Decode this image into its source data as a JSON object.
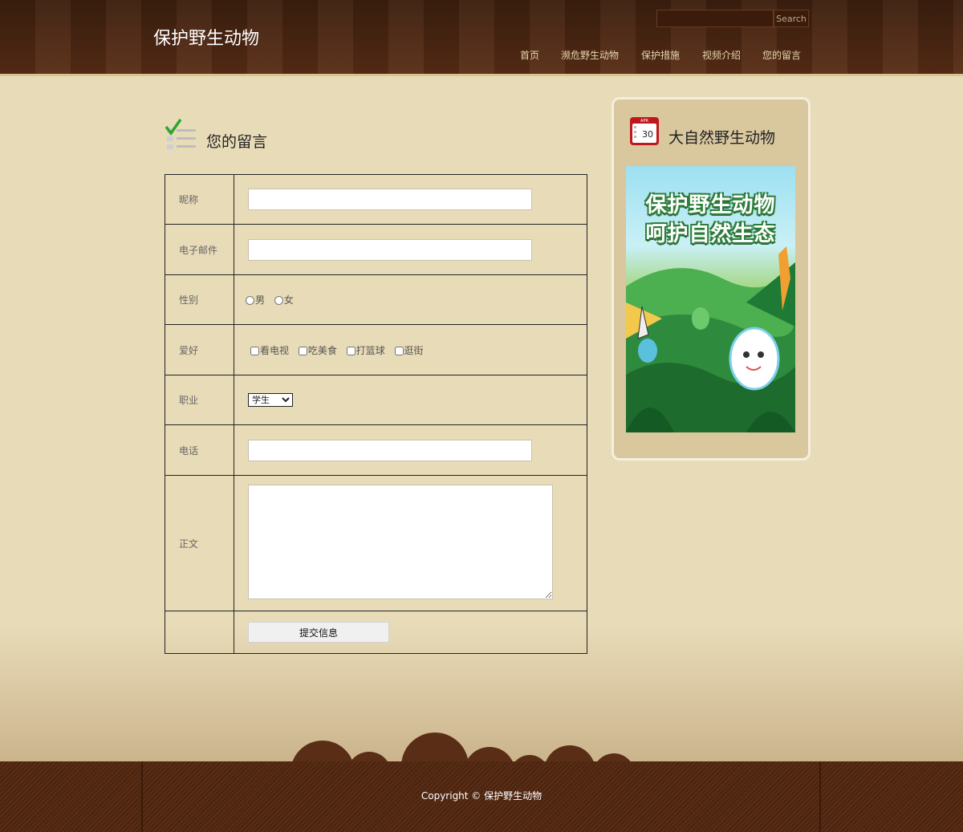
{
  "header": {
    "site_title": "保护野生动物",
    "search_placeholder": "",
    "search_button": "Search",
    "nav": [
      "首页",
      "濒危野生动物",
      "保护措施",
      "视频介绍",
      "您的留言"
    ]
  },
  "main": {
    "section_title": "您的留言",
    "section_icon": "checklist-icon",
    "form": {
      "nickname_label": "昵称",
      "email_label": "电子邮件",
      "gender_label": "性别",
      "gender_options": [
        "男",
        "女"
      ],
      "hobby_label": "爱好",
      "hobby_options": [
        "看电视",
        "吃美食",
        "打篮球",
        "逛街"
      ],
      "job_label": "职业",
      "job_selected": "学生",
      "phone_label": "电话",
      "body_label": "正文",
      "submit_label": "提交信息"
    }
  },
  "sidebar": {
    "title": "大自然野生动物",
    "icon": "calendar-icon",
    "calendar_day": "30",
    "calendar_month": "APR",
    "poster_line1": "保护野生动物",
    "poster_line2": "呵护自然生态"
  },
  "footer": {
    "copyright": "Copyright © 保护野生动物"
  },
  "colors": {
    "header_bg": "#4a2512",
    "page_bg": "#e8dbb8",
    "sidebar_bg": "#d9c79e",
    "footer_bg": "#4f2712"
  }
}
